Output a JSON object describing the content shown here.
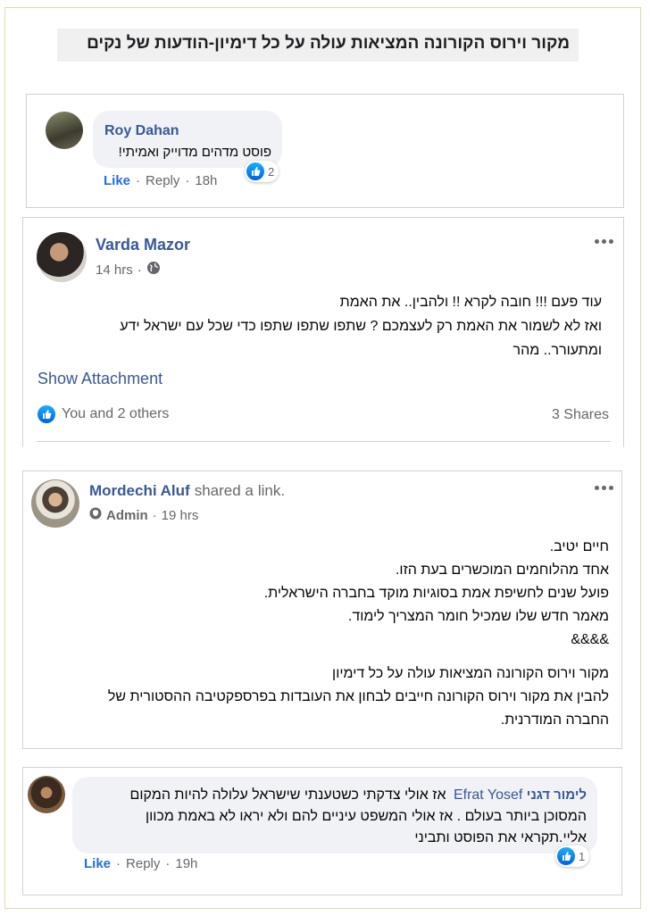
{
  "page": {
    "title": "מקור וירוס הקורונה המציאות עולה על כל דימיון-הודעות של נקים"
  },
  "comment1": {
    "author": "Roy Dahan",
    "text": "פוסט מדהים מדוייק ואמיתי!",
    "like_label": "Like",
    "reply_label": "Reply",
    "time": "18h",
    "reaction_count": "2"
  },
  "post1": {
    "author": "Varda Mazor",
    "time": "14 hrs",
    "lines": [
      "עוד פעם !!! חובה לקרא !! ולהבין.. את האמת",
      "ואז לא לשמור את האמת רק לעצמכם ? שתפו שתפו שתפו כדי שכל עם ישראל ידע",
      "ומתעורר.. מהר"
    ],
    "show_attachment": "Show Attachment",
    "reactions_text": "You and 2 others",
    "shares": "3 Shares"
  },
  "post2": {
    "author": "Mordechi Aluf",
    "shared_text": "shared a",
    "link_text": "link",
    "role": "Admin",
    "time": "19 hrs",
    "lines": [
      "חיים יטיב.",
      "אחד מהלוחמים המוכשרים בעת הזו.",
      "פועל שנים לחשיפת אמת בסוגיות מוקד בחברה הישראלית.",
      "מאמר חדש שלו שמכיל חומר המצריך לימוד.",
      "&&&&"
    ],
    "lines2": [
      "מקור וירוס הקורונה המציאות עולה על כל דימיון",
      "להבין את מקור וירוס הקורונה חייבים לבחון את העובדות בפרספקטיבה ההסטורית של",
      "החברה המודרנית."
    ]
  },
  "comment2": {
    "author": "לימור דגני",
    "tagged": "Efrat Yosef",
    "text_line1": "אז אולי צדקתי כשטענתי שישראל עלולה להיות המקום",
    "text_line2": "המסוכן ביותר בעולם . אז אולי המשפט עיניים להם ולא יראו לא באמת מכוון",
    "text_line3": "אליי.תקראי את הפוסט ותביני",
    "like_label": "Like",
    "reply_label": "Reply",
    "time": "19h",
    "reaction_count": "1"
  },
  "icons": [
    "like-icon",
    "globe-icon",
    "more-options-icon",
    "admin-shield-icon"
  ],
  "colors": {
    "name": "#385898",
    "link": "#216fdb",
    "grey": "#65676b",
    "bubble": "#f0f2f5",
    "frame": "#e7d7a8"
  }
}
